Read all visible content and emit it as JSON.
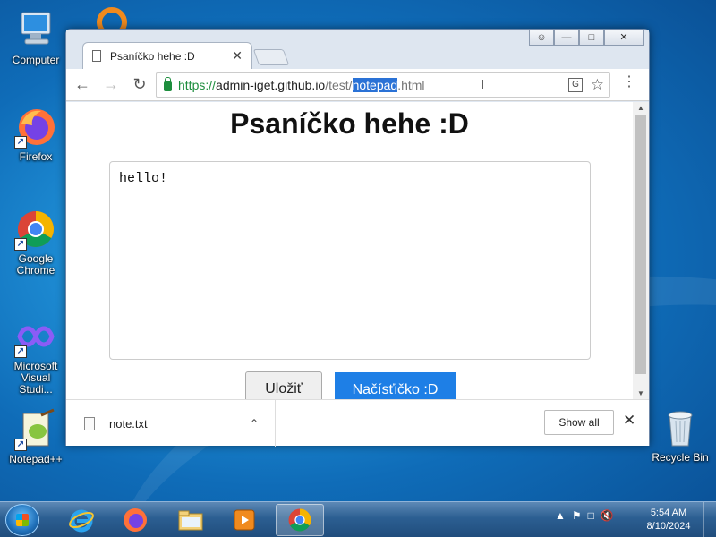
{
  "desktop": {
    "icons": [
      {
        "label": "Computer",
        "icon": "computer-icon"
      },
      {
        "label": "Firefox",
        "icon": "firefox-icon"
      },
      {
        "label": "Google Chrome",
        "icon": "chrome-icon"
      },
      {
        "label": "Microsoft Visual Studi...",
        "icon": "visual-studio-icon"
      },
      {
        "label": "Notepad++",
        "icon": "notepadpp-icon"
      },
      {
        "label": "Recycle Bin",
        "icon": "recycle-bin-icon"
      }
    ]
  },
  "browser": {
    "tab_title": "Psaníčko hehe :D",
    "url": {
      "scheme": "https://",
      "host": "admin-iget.github.io",
      "path_before": "/test/",
      "selected": "notepad",
      "path_after": ".html"
    },
    "page": {
      "title": "Psaníčko hehe :D",
      "textarea_value": "hello!",
      "save_label": "Uložiť",
      "load_label": "Načísťičko :D"
    },
    "download_bar": {
      "file_name": "note.txt",
      "show_all_label": "Show all"
    }
  },
  "taskbar": {
    "apps": [
      "internet-explorer-icon",
      "firefox-icon",
      "file-explorer-icon",
      "media-player-icon",
      "chrome-icon"
    ],
    "active_app": "chrome-icon",
    "time": "5:54 AM",
    "date": "8/10/2024"
  },
  "colors": {
    "accent_button": "#1e7fe6",
    "selection": "#2a72d6",
    "secure_green": "#1e8e3e"
  }
}
